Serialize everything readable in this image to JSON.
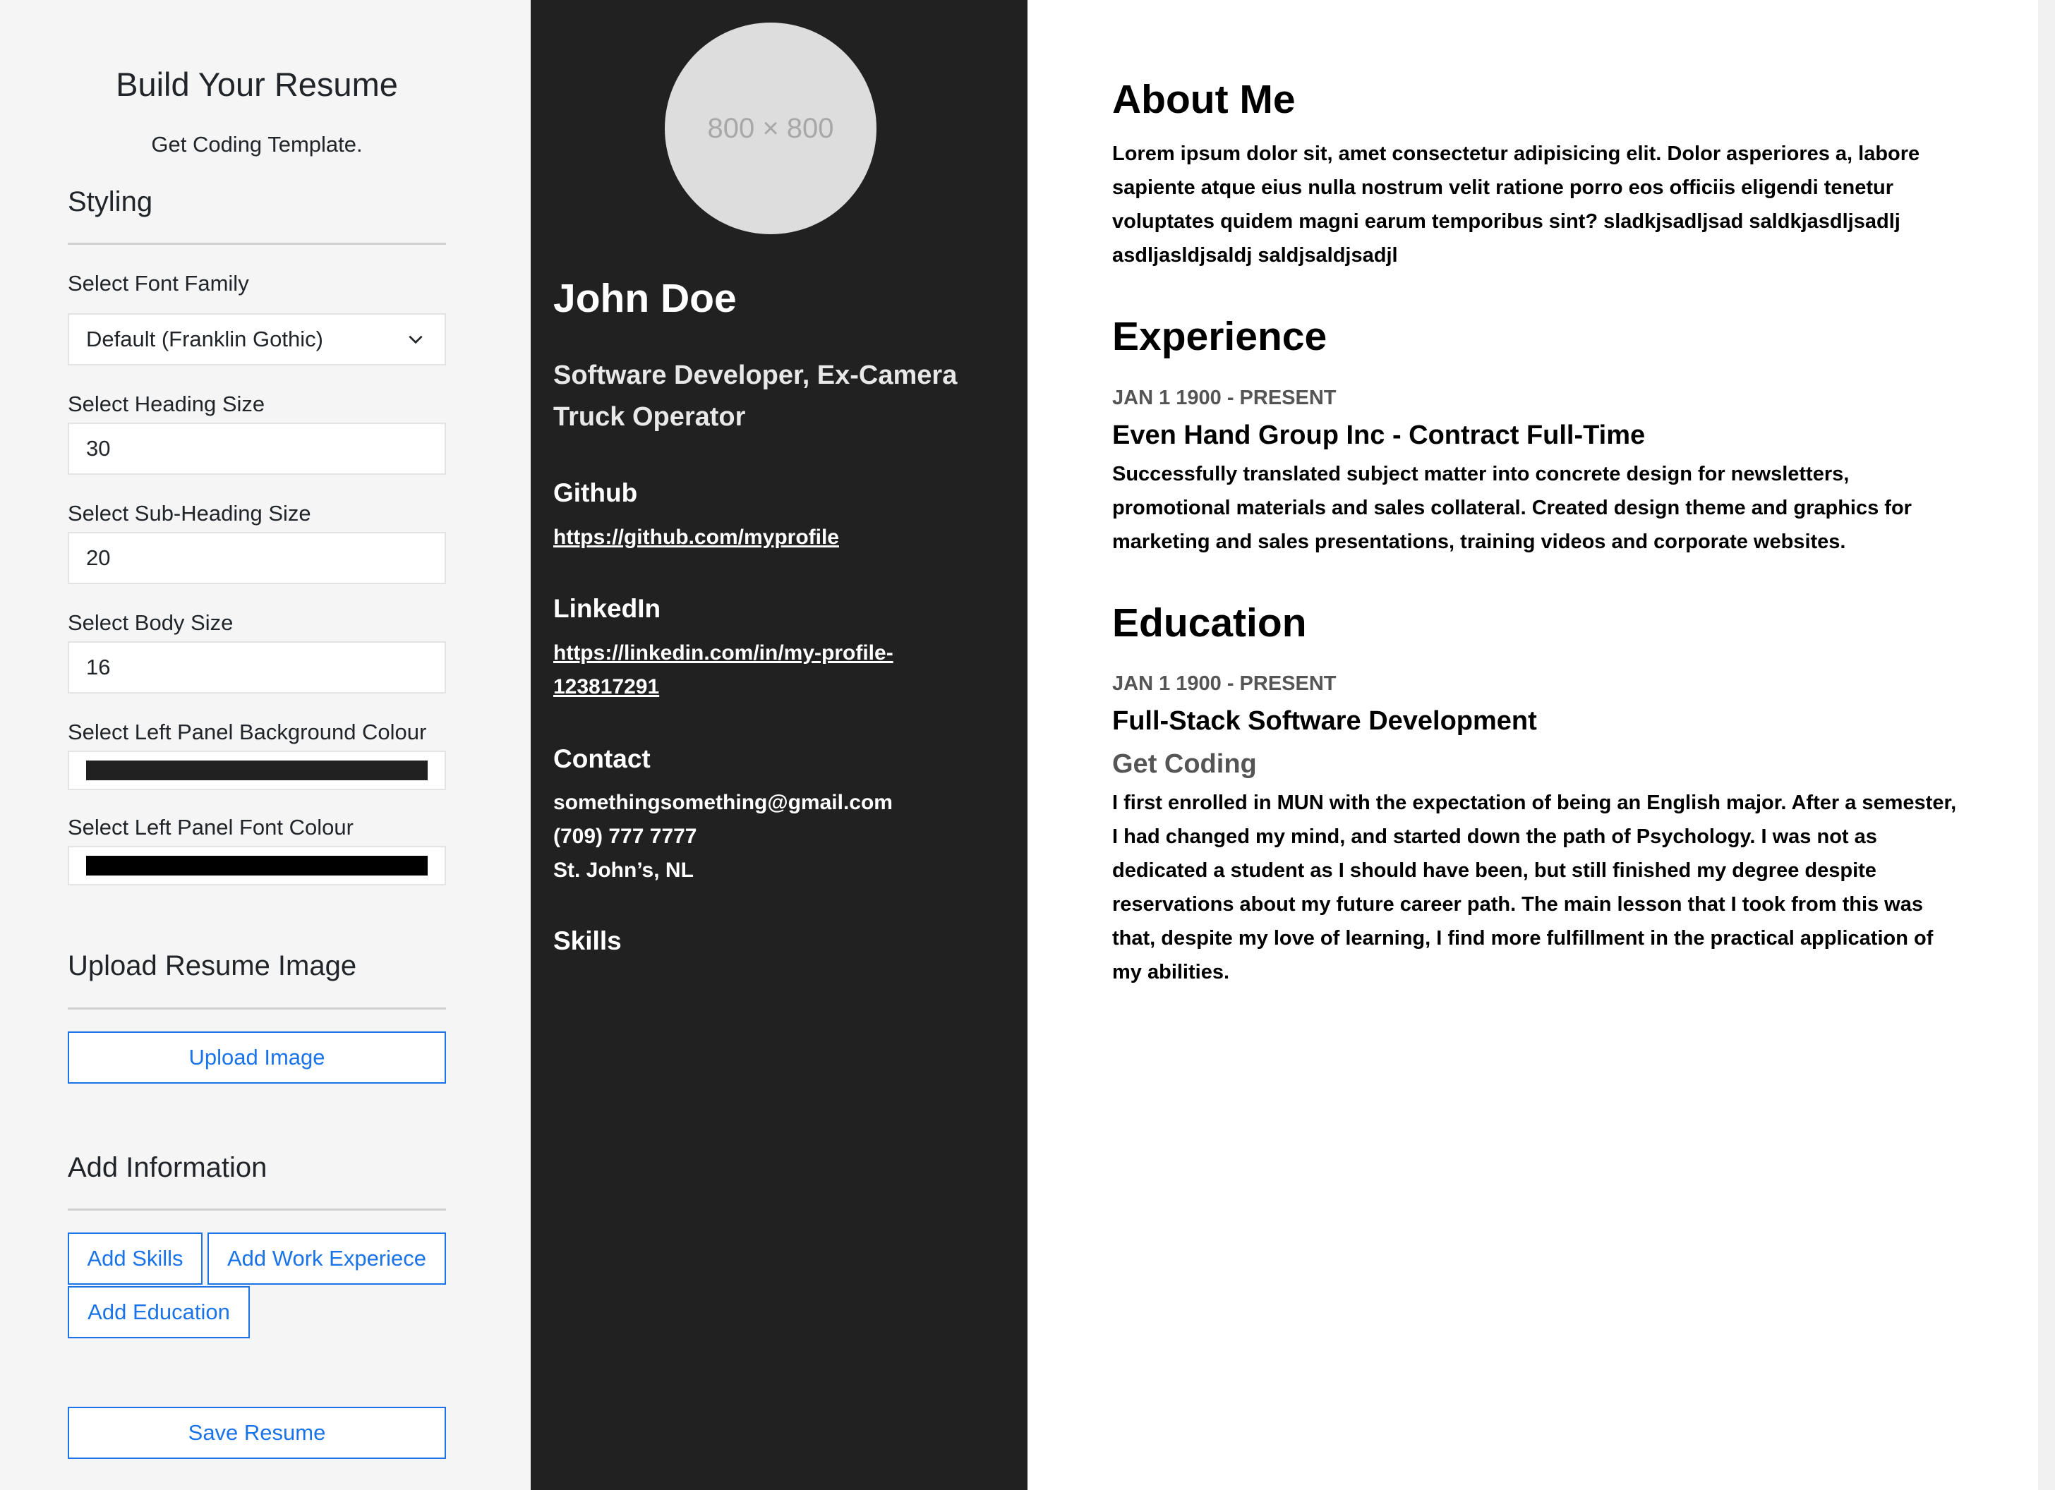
{
  "builder": {
    "title": "Build Your Resume",
    "subtitle": "Get Coding Template.",
    "styling": {
      "heading": "Styling",
      "font_family": {
        "label": "Select Font Family",
        "value": "Default (Franklin Gothic)"
      },
      "heading_size": {
        "label": "Select Heading Size",
        "value": "30"
      },
      "subheading_size": {
        "label": "Select Sub-Heading Size",
        "value": "20"
      },
      "body_size": {
        "label": "Select Body Size",
        "value": "16"
      },
      "left_bg_colour": {
        "label": "Select Left Panel Background Colour",
        "value": "#212121"
      },
      "left_font_colour": {
        "label": "Select Left Panel Font Colour",
        "value": "#000000"
      }
    },
    "upload": {
      "heading": "Upload Resume Image",
      "button": "Upload Image"
    },
    "add_info": {
      "heading": "Add Information",
      "add_skills": "Add Skills",
      "add_work": "Add Work Experiece",
      "add_education": "Add Education"
    },
    "save_button": "Save Resume",
    "accent_color": "#1a73e8"
  },
  "resume": {
    "image_placeholder": "800 × 800",
    "name": "John Doe",
    "title": "Software Developer, Ex-Camera Truck Operator",
    "github": {
      "heading": "Github",
      "url": "https://github.com/myprofile"
    },
    "linkedin": {
      "heading": "LinkedIn",
      "url": "https://linkedin.com/in/my-profile-123817291"
    },
    "contact": {
      "heading": "Contact",
      "email": "somethingsomething@gmail.com",
      "phone": "(709) 777 7777",
      "location": "St. John’s, NL"
    },
    "skills": {
      "heading": "Skills"
    },
    "about": {
      "heading": "About Me",
      "text": "Lorem ipsum dolor sit, amet consectetur adipisicing elit. Dolor asperiores a, labore sapiente atque eius nulla nostrum velit ratione porro eos officiis eligendi tenetur voluptates quidem magni earum temporibus sint? sladkjsadljsad saldkjasdljsadlj asdljasldjsaldj saldjsaldjsadjl"
    },
    "experience": {
      "heading": "Experience",
      "items": [
        {
          "dates": "JAN 1 1900 - PRESENT",
          "title": "Even Hand Group Inc - Contract Full-Time",
          "description": "Successfully translated subject matter into concrete design for newsletters, promotional materials and sales collateral. Created design theme and graphics for marketing and sales presentations, training videos and corporate websites."
        }
      ]
    },
    "education": {
      "heading": "Education",
      "items": [
        {
          "dates": "JAN 1 1900 - PRESENT",
          "title": "Full-Stack Software Development",
          "school": "Get Coding",
          "description": "I first enrolled in MUN with the expectation of being an English major. After a semester, I had changed my mind, and started down the path of Psychology. I was not as dedicated a student as I should have been, but still finished my degree despite reservations about my future career path. The main lesson that I took from this was that, despite my love of learning, I find more fulfillment in the practical application of my abilities."
        }
      ]
    }
  }
}
